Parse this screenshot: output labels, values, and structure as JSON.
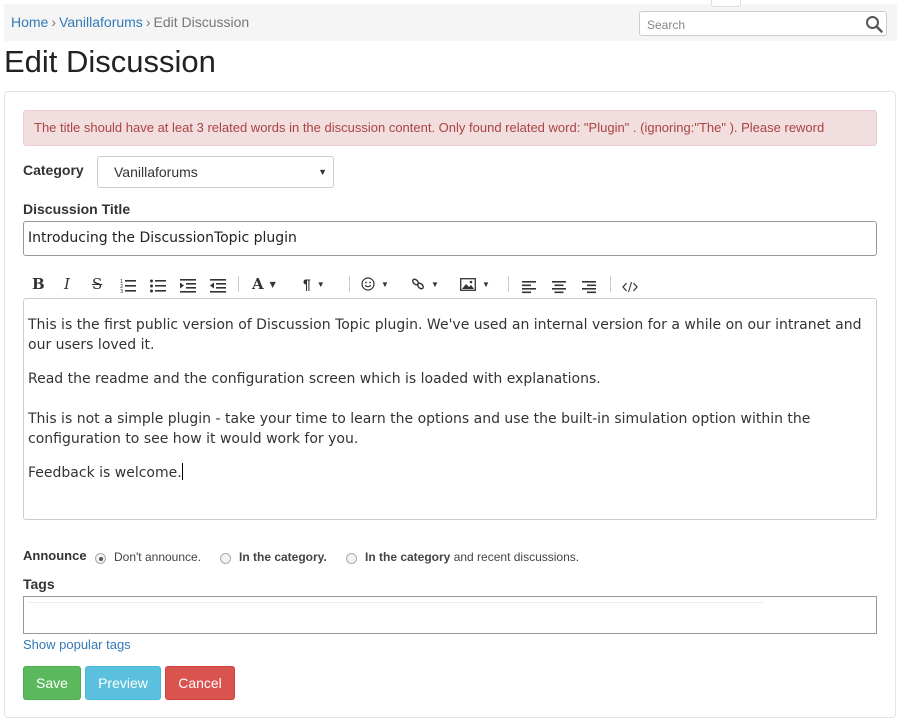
{
  "breadcrumb": {
    "items": [
      "Home",
      "Vanillaforums",
      "Edit Discussion"
    ],
    "separator": "›"
  },
  "search": {
    "placeholder": "Search"
  },
  "page_title": "Edit Discussion",
  "alert": {
    "text": "The title should have at leat 3 related words in the discussion content. Only found related word: \"Plugin\" . (ignoring:\"The\" ). Please reword"
  },
  "category": {
    "label": "Category",
    "selected": "Vanillaforums"
  },
  "discussion_title": {
    "label": "Discussion Title",
    "value": "Introducing the DiscussionTopic plugin"
  },
  "toolbar": {
    "bold": "B",
    "italic": "I",
    "strike": "S",
    "font": "A",
    "paragraph": "¶"
  },
  "body": {
    "paragraphs": [
      "This is the first public version of Discussion Topic plugin. We've used an internal version for a while on our intranet and our users loved it.",
      "Read the readme and the configuration screen which is loaded with explanations.",
      "This is not a simple plugin - take your time to learn the options and use the built-in simulation option within the configuration to see how it would work for you.",
      "Feedback is welcome."
    ]
  },
  "announce": {
    "label": "Announce",
    "options": [
      {
        "text": "Don't announce.",
        "checked": true
      },
      {
        "bold": "In the category.",
        "rest": "",
        "checked": false
      },
      {
        "bold": "In the category",
        "rest": " and recent discussions.",
        "checked": false
      }
    ]
  },
  "tags": {
    "label": "Tags",
    "popular_link": "Show popular tags"
  },
  "buttons": {
    "save": "Save",
    "preview": "Preview",
    "cancel": "Cancel"
  },
  "colors": {
    "link": "#337ab7",
    "alert_bg": "#f2dede",
    "alert_text": "#a94442",
    "save": "#5cb85c",
    "preview": "#5bc0de",
    "cancel": "#d9534f"
  }
}
